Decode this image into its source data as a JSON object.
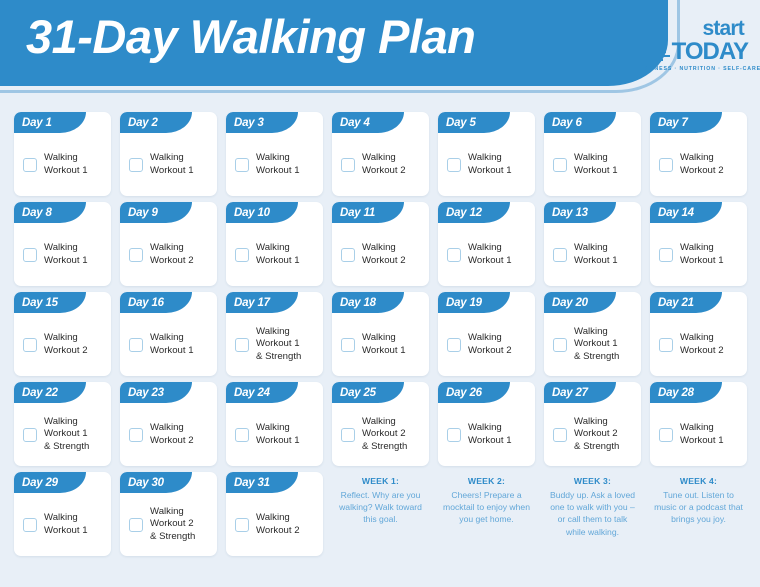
{
  "header": {
    "title": "31-Day Walking Plan",
    "logo": {
      "start": "start",
      "today": "TODAY",
      "tagline": "FITNESS · NUTRITION · SELF-CARE"
    },
    "accent_color": "#2e8bc9",
    "background_color": "#e8eff7"
  },
  "days": [
    {
      "label": "Day 1",
      "workout": "Walking\nWorkout 1"
    },
    {
      "label": "Day 2",
      "workout": "Walking\nWorkout 1"
    },
    {
      "label": "Day 3",
      "workout": "Walking\nWorkout 1"
    },
    {
      "label": "Day 4",
      "workout": "Walking\nWorkout 2"
    },
    {
      "label": "Day 5",
      "workout": "Walking\nWorkout 1"
    },
    {
      "label": "Day 6",
      "workout": "Walking\nWorkout 1"
    },
    {
      "label": "Day 7",
      "workout": "Walking\nWorkout 2"
    },
    {
      "label": "Day 8",
      "workout": "Walking\nWorkout 1"
    },
    {
      "label": "Day 9",
      "workout": "Walking\nWorkout 2"
    },
    {
      "label": "Day 10",
      "workout": "Walking\nWorkout 1"
    },
    {
      "label": "Day 11",
      "workout": "Walking\nWorkout 2"
    },
    {
      "label": "Day 12",
      "workout": "Walking\nWorkout 1"
    },
    {
      "label": "Day 13",
      "workout": "Walking\nWorkout 1"
    },
    {
      "label": "Day 14",
      "workout": "Walking\nWorkout 1"
    },
    {
      "label": "Day 15",
      "workout": "Walking\nWorkout 2"
    },
    {
      "label": "Day 16",
      "workout": "Walking\nWorkout 1"
    },
    {
      "label": "Day 17",
      "workout": "Walking\nWorkout 1\n& Strength"
    },
    {
      "label": "Day 18",
      "workout": "Walking\nWorkout 1"
    },
    {
      "label": "Day 19",
      "workout": "Walking\nWorkout 2"
    },
    {
      "label": "Day 20",
      "workout": "Walking\nWorkout 1\n& Strength"
    },
    {
      "label": "Day 21",
      "workout": "Walking\nWorkout 2"
    },
    {
      "label": "Day 22",
      "workout": "Walking\nWorkout 1\n& Strength"
    },
    {
      "label": "Day 23",
      "workout": "Walking\nWorkout 2"
    },
    {
      "label": "Day 24",
      "workout": "Walking\nWorkout 1"
    },
    {
      "label": "Day 25",
      "workout": "Walking\nWorkout 2\n& Strength"
    },
    {
      "label": "Day 26",
      "workout": "Walking\nWorkout 1"
    },
    {
      "label": "Day 27",
      "workout": "Walking\nWorkout 2\n& Strength"
    },
    {
      "label": "Day 28",
      "workout": "Walking\nWorkout 1"
    },
    {
      "label": "Day 29",
      "workout": "Walking\nWorkout 1"
    },
    {
      "label": "Day 30",
      "workout": "Walking\nWorkout 2\n& Strength"
    },
    {
      "label": "Day 31",
      "workout": "Walking\nWorkout 2"
    }
  ],
  "week_notes": [
    {
      "title": "WEEK 1:",
      "body": "Reflect. Why are you walking? Walk toward this goal."
    },
    {
      "title": "WEEK 2:",
      "body": "Cheers! Prepare a mocktail to enjoy when you get home."
    },
    {
      "title": "WEEK 3:",
      "body": "Buddy up. Ask a loved one to walk with you – or call them to talk while walking."
    },
    {
      "title": "WEEK 4:",
      "body": "Tune out. Listen to music or a podcast that brings you joy."
    }
  ]
}
